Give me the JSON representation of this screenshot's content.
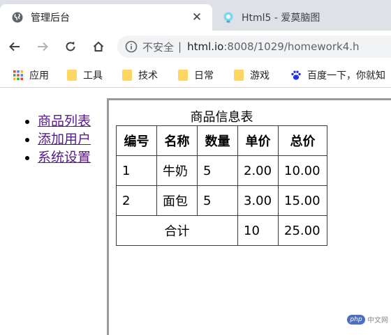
{
  "browser": {
    "tabs": [
      {
        "title": "管理后台",
        "active": true,
        "icon": "globe-icon"
      },
      {
        "title": "Html5 - 爱莫脑图",
        "active": false,
        "icon": "bulb-icon"
      }
    ],
    "address": {
      "security": "不安全",
      "separator": "|",
      "host": "html.io",
      "rest": ":8008/1029/homework4.h"
    },
    "bookmarks": [
      {
        "label": "应用",
        "icon": "apps-grid-icon"
      },
      {
        "label": "工具",
        "icon": "folder-icon"
      },
      {
        "label": "技术",
        "icon": "folder-icon"
      },
      {
        "label": "日常",
        "icon": "folder-icon"
      },
      {
        "label": "游戏",
        "icon": "folder-icon"
      },
      {
        "label": "百度一下，你就知",
        "icon": "baidu-paw-icon"
      }
    ]
  },
  "page": {
    "menu": [
      "商品列表",
      "添加用户",
      "系统设置"
    ],
    "table": {
      "caption": "商品信息表",
      "headers": [
        "编号",
        "名称",
        "数量",
        "单价",
        "总价"
      ],
      "rows": [
        [
          "1",
          "牛奶",
          "5",
          "2.00",
          "10.00"
        ],
        [
          "2",
          "面包",
          "5",
          "3.00",
          "15.00"
        ]
      ],
      "footer": {
        "label": "合计",
        "quantity": "10",
        "total": "25.00"
      }
    },
    "watermark": {
      "logo": "php",
      "text": "中文网"
    }
  },
  "colors": {
    "tabstrip": "#dee1e6",
    "omnibox": "#f1f3f4",
    "visited_link": "#551a8b",
    "frame_border": "#9a9a9a"
  }
}
